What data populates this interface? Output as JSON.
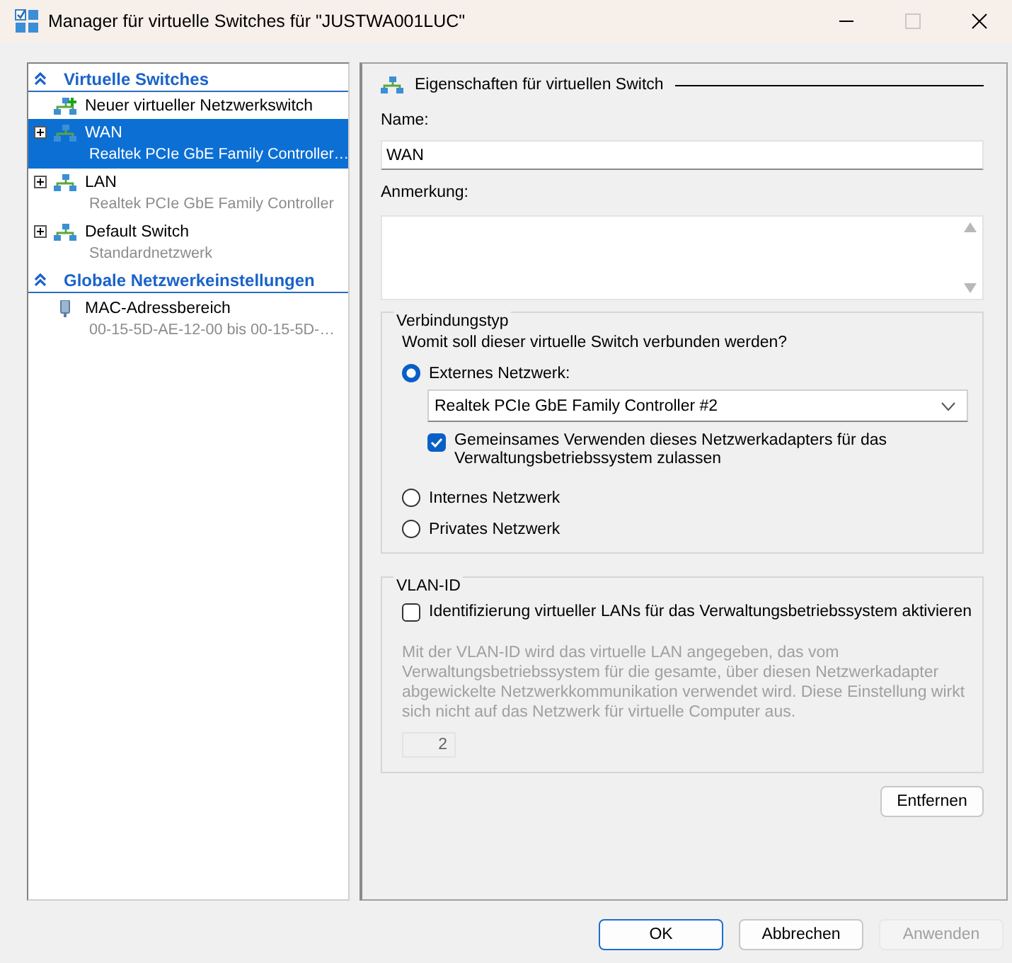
{
  "window": {
    "title": "Manager für virtuelle Switches für \"JUSTWA001LUC\"",
    "maximize_disabled": true
  },
  "sidebar": {
    "sections": [
      {
        "title": "Virtuelle Switches",
        "items": [
          {
            "kind": "new",
            "label": "Neuer virtueller Netzwerkswitch",
            "selected": false
          },
          {
            "kind": "switch",
            "label": "WAN",
            "detail": "Realtek PCIe GbE Family Controller…",
            "selected": true
          },
          {
            "kind": "switch",
            "label": "LAN",
            "detail": "Realtek PCIe GbE Family Controller",
            "selected": false
          },
          {
            "kind": "switch",
            "label": "Default Switch",
            "detail": "Standardnetzwerk",
            "selected": false
          }
        ]
      },
      {
        "title": "Globale Netzwerkeinstellungen",
        "items": [
          {
            "kind": "mac",
            "label": "MAC-Adressbereich",
            "detail": "00-15-5D-AE-12-00 bis 00-15-5D-…",
            "selected": false
          }
        ]
      }
    ]
  },
  "properties": {
    "heading": "Eigenschaften für virtuellen Switch",
    "name_label": "Name:",
    "name_value": "WAN",
    "note_label": "Anmerkung:",
    "connection": {
      "legend": "Verbindungstyp",
      "question": "Womit soll dieser virtuelle Switch verbunden werden?",
      "options": [
        {
          "label": "Externes Netzwerk:",
          "selected": true
        },
        {
          "label": "Internes Netzwerk",
          "selected": false
        },
        {
          "label": "Privates Netzwerk",
          "selected": false
        }
      ],
      "adapter": "Realtek PCIe GbE Family Controller #2",
      "share": {
        "label": "Gemeinsames Verwenden dieses Netzwerkadapters für das Verwaltungsbetriebssystem zulassen",
        "checked": true
      }
    },
    "vlan": {
      "legend": "VLAN-ID",
      "checkbox": {
        "label": "Identifizierung virtueller LANs für das Verwaltungsbetriebssystem aktivieren",
        "checked": false
      },
      "description": "Mit der VLAN-ID wird das virtuelle LAN angegeben, das vom Verwaltungsbetriebssystem für die gesamte, über diesen Netzwerkadapter abgewickelte Netzwerkkommunikation verwendet wird. Diese Einstellung wirkt sich nicht auf das Netzwerk für virtuelle Computer aus.",
      "id_value": "2"
    },
    "remove_button": "Entfernen"
  },
  "buttons": [
    {
      "label": "OK",
      "default": true,
      "disabled": false
    },
    {
      "label": "Abbrechen",
      "default": false,
      "disabled": false
    },
    {
      "label": "Anwenden",
      "default": false,
      "disabled": true
    }
  ]
}
